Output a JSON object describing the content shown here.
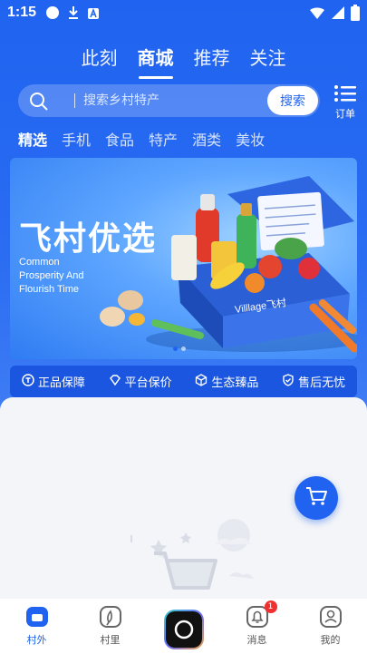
{
  "status_bar": {
    "time": "1:15"
  },
  "top_tabs": [
    {
      "label": "此刻",
      "active": false
    },
    {
      "label": "商城",
      "active": true
    },
    {
      "label": "推荐",
      "active": false
    },
    {
      "label": "关注",
      "active": false
    }
  ],
  "search": {
    "placeholder": "搜索乡村特产",
    "button_label": "搜索"
  },
  "orders_label": "订单",
  "categories": [
    {
      "label": "精选",
      "active": true
    },
    {
      "label": "手机",
      "active": false
    },
    {
      "label": "食品",
      "active": false
    },
    {
      "label": "特产",
      "active": false
    },
    {
      "label": "酒类",
      "active": false
    },
    {
      "label": "美妆",
      "active": false
    }
  ],
  "banner": {
    "title": "飞村优选",
    "subtitle_lines": [
      "Common",
      "Prosperity And",
      "Flourish Time"
    ],
    "box_brand": "Villlage飞村",
    "slide_count": 2,
    "active_slide": 1
  },
  "guarantees": [
    {
      "label": "正品保障",
      "icon": "genuine-icon"
    },
    {
      "label": "平台保价",
      "icon": "diamond-icon"
    },
    {
      "label": "生态臻品",
      "icon": "cube-icon"
    },
    {
      "label": "售后无忧",
      "icon": "shield-check-icon"
    }
  ],
  "bottom_nav": [
    {
      "label": "村外",
      "icon": "village-outside-icon",
      "active": true
    },
    {
      "label": "村里",
      "icon": "village-inside-icon",
      "active": false
    },
    {
      "label": "",
      "icon": "camera-icon",
      "active": false
    },
    {
      "label": "消息",
      "icon": "bell-icon",
      "active": false,
      "badge": "1"
    },
    {
      "label": "我的",
      "icon": "profile-icon",
      "active": false
    }
  ],
  "colors": {
    "primary": "#1f63f0",
    "badge": "#f03030"
  }
}
